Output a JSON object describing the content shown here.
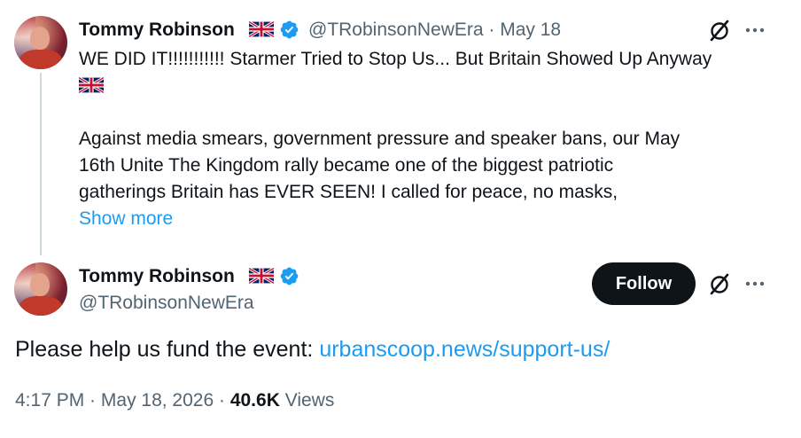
{
  "reply_tweet": {
    "author_name": "Tommy Robinson",
    "handle": "@TRobinsonNewEra",
    "separator": " · ",
    "date": "May 18",
    "line1": "WE DID IT!!!!!!!!!!! Starmer Tried to Stop Us... But Britain Showed Up Anyway",
    "line3": "Against media smears, government pressure and speaker bans, our May",
    "line4": "16th Unite The Kingdom rally became one of the biggest patriotic",
    "line5": "gatherings Britain has EVER SEEN! I called for peace, no masks,",
    "show_more": "Show more"
  },
  "main_tweet": {
    "author_name": "Tommy Robinson",
    "handle": "@TRobinsonNewEra",
    "follow_label": "Follow",
    "text_prefix": "Please help us fund the event: ",
    "link_text": "urbanscoop.news/support-us/",
    "time": "4:17 PM",
    "sep": " · ",
    "date": "May 18, 2026",
    "views_count": "40.6K",
    "views_label": " Views"
  },
  "icons": {
    "grok": "grok-slash-icon",
    "more": "more-horizontal-icon",
    "verified": "verified-badge-icon",
    "flag": "uk-flag-emoji"
  },
  "colors": {
    "link": "#1d9bf0",
    "verified": "#1d9bf0",
    "muted": "#536471",
    "text": "#0f1419",
    "follow_bg": "#0f1419"
  }
}
